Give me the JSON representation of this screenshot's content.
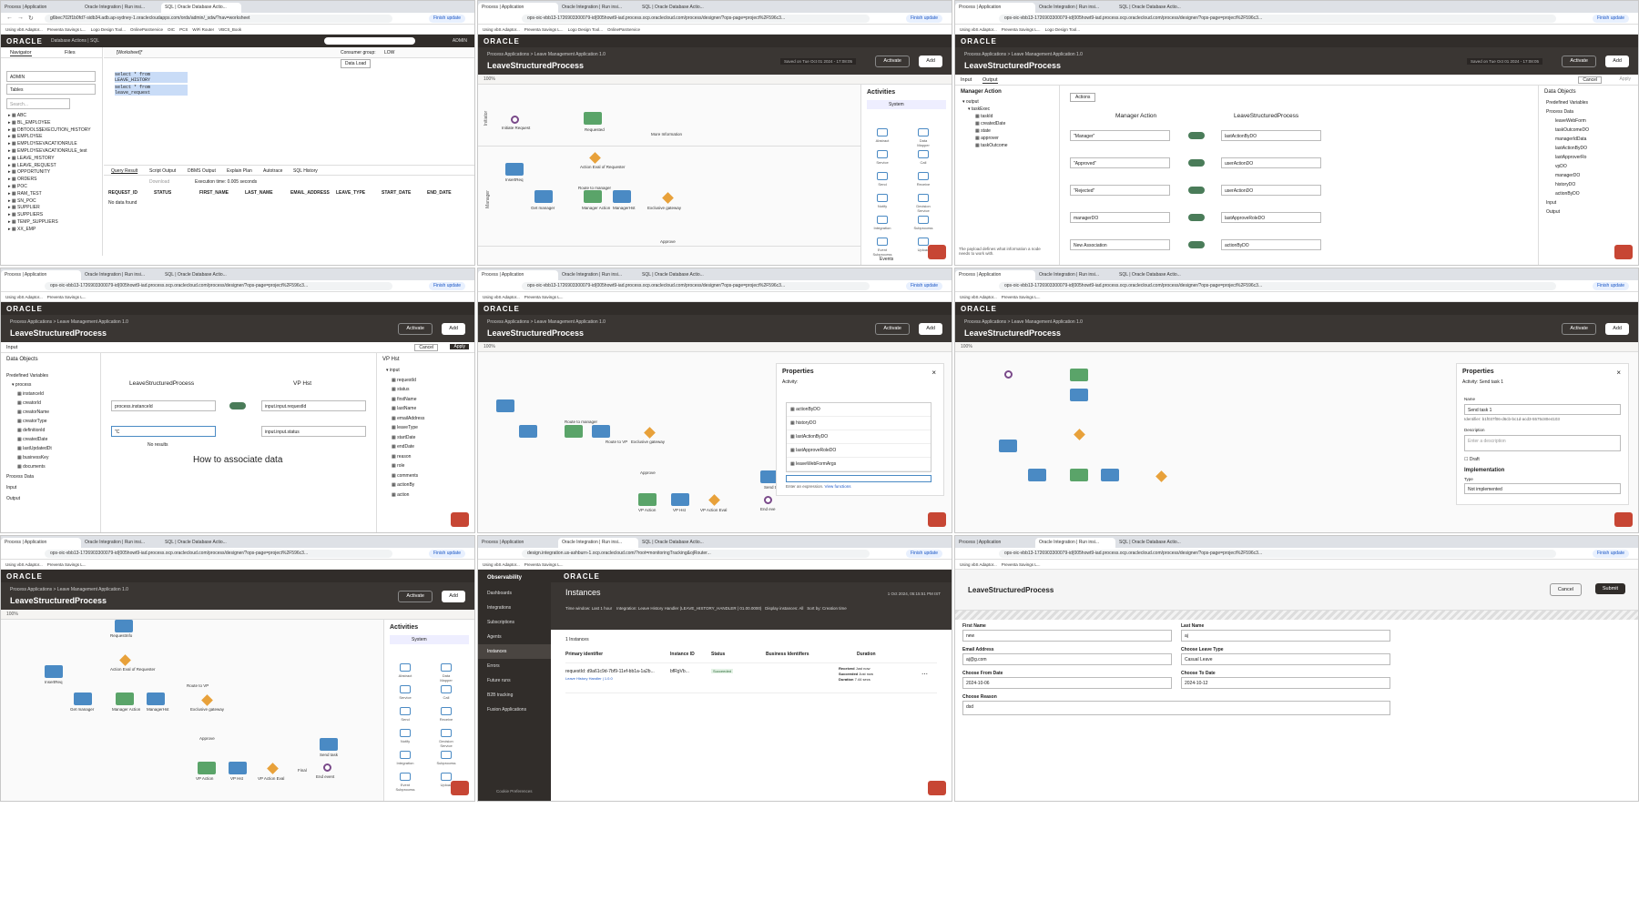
{
  "panels": [
    {
      "id": "p1",
      "tabs": [
        "Process | Application",
        "Oracle Integration | Run insi...",
        "SQL | Oracle Database Actio..."
      ],
      "url": "g6bec702f1b0fd7-sidb34.adb.ap-sydney-1.oraclecloudapps.com/ords/admin/_sdw/?nav=worksheet",
      "app_title": "Database Actions | SQL",
      "nav_tabs": [
        "Navigator",
        "Files"
      ],
      "schema": "ADMIN",
      "object_type": "Tables",
      "search_placeholder": "Search...",
      "tables": [
        "ABC",
        "BL_EMPLOYEE",
        "DBTOOLS$EXECUTION_HISTORY",
        "EMPLOYEE",
        "EMPLOYEEVACATIONRULE",
        "EMPLOYEEVACATIONRULE_test",
        "LEAVE_HISTORY",
        "LEAVE_REQUEST",
        "OPPORTUNITY",
        "ORDERS",
        "POC",
        "RAM_TEST",
        "SN_POC",
        "SUPPLIER",
        "SUPPLIERS",
        "TEMP_SUPPLIERS",
        "XX_EMP"
      ],
      "worksheet": "[Worksheet]*",
      "consumer_group_label": "Consumer group:",
      "consumer_group": "LOW",
      "data_load": "Data Load",
      "sql_lines": [
        "select * from LEAVE_HISTORY",
        "select * from leave_request"
      ],
      "result_tabs": [
        "Query Result",
        "Script Output",
        "DBMS Output",
        "Explain Plan",
        "Autotrace",
        "SQL History"
      ],
      "download": "Download",
      "exec_time": "Execution time: 0.005 seconds",
      "columns": [
        "REQUEST_ID",
        "STATUS",
        "FIRST_NAME",
        "LAST_NAME",
        "EMAIL_ADDRESS",
        "LEAVE_TYPE",
        "START_DATE",
        "END_DATE"
      ],
      "no_data": "No data found",
      "user": "ADMIN"
    },
    {
      "id": "p2",
      "crumb": "Process Applications  >  Leave Management Application 1.0",
      "title": "LeaveStructuredProcess",
      "activate": "Activate",
      "add": "Add",
      "zoom": "100%",
      "palette_title": "Activities",
      "palette_section": "System",
      "palette_items": [
        "Abstract",
        "Data Mapper",
        "Service",
        "Call",
        "Send",
        "Receive",
        "Notify",
        "Decision Service",
        "Integration",
        "Subprocess",
        "Event Subprocess",
        "Upload"
      ],
      "events": "Events",
      "nodes": [
        "Initiate Request",
        "Requested",
        "More Information",
        "Action Eval of Requester",
        "InsertReq",
        "Get manager",
        "Manager Action",
        "ManagerHst",
        "Exclusive gateway",
        "Route to manager",
        "Approve"
      ],
      "lanes": [
        "Initiator",
        "Manager",
        "VP"
      ]
    },
    {
      "id": "p3",
      "tabs_io": [
        "Input",
        "Output"
      ],
      "cancel": "Cancel",
      "apply": "Apply",
      "left_title": "Manager Action",
      "actions": "Actions",
      "center_left": "Manager Action",
      "center_right": "LeaveStructuredProcess",
      "output_tree": [
        "output",
        "taskExec",
        "taskId",
        "createdDate",
        "state",
        "approver",
        "taskOutcome"
      ],
      "mappings": [
        {
          "src": "\"Manager\"",
          "dst": "lastActionByDO"
        },
        {
          "src": "\"Approved\"",
          "dst": "userActionDO"
        },
        {
          "src": "\"Rejected\"",
          "dst": "userActionDO"
        },
        {
          "src": "managerDO",
          "dst": "lastApproveRoleDO"
        },
        {
          "src": "New Association",
          "dst": "actionByDO"
        }
      ],
      "data_objects_title": "Data Objects",
      "data_objects": [
        "Predefined Variables",
        "Process Data",
        "leaveWebForm",
        "taskOutcomeDO",
        "managerIdData",
        "lastActionByDO",
        "lastApproverRo",
        "vpDO",
        "managerDO",
        "historyDO",
        "actionByDO",
        "Input",
        "Output"
      ],
      "hint": "The payload defines what information a node needs to work with."
    },
    {
      "id": "p4",
      "input_tab": "Input",
      "cancel": "Cancel",
      "apply": "Apply",
      "data_objects_title": "Data Objects",
      "predefined": "Predefined Variables",
      "process_tree": [
        "process",
        "instanceId",
        "creatorId",
        "creatorName",
        "creatorType",
        "definitionId",
        "createdDate",
        "lastUpdatedDt",
        "businessKey",
        "documents"
      ],
      "process_data": "Process Data",
      "input": "Input",
      "output": "Output",
      "center_left": "LeaveStructuredProcess",
      "center_right": "VP Hst",
      "map_src": "process.instanceId",
      "map_dst": "input.input.requestId",
      "map_dst2": "input.input.status",
      "typing": "\"C",
      "no_results": "No results",
      "howto_title": "How to associate data",
      "right_title": "VP Hst",
      "right_tree": [
        "input",
        "requestId",
        "status",
        "firstName",
        "lastName",
        "emailAddress",
        "leaveType",
        "startDate",
        "endDate",
        "reason",
        "role",
        "comments",
        "actionBy",
        "action"
      ]
    },
    {
      "id": "p5",
      "props_title": "Properties",
      "props_sub": "Activity:",
      "list_items": [
        "actionByDO",
        "historyDO",
        "lastActionByDO",
        "lastApproveRoleDO",
        "leaveWebFormArgs"
      ],
      "expr_hint": "Enter an expression.",
      "view_functions": "View functions",
      "nodes": [
        "VP Action",
        "VP Hst",
        "VP Action Eval",
        "End eve",
        "Send ta",
        "Approve",
        "Exclusive gateway",
        "Route to VP",
        "Route to manager"
      ]
    },
    {
      "id": "p6",
      "props_title": "Properties",
      "props_sub": "Activity: Send task 1",
      "name_label": "Name",
      "name_value": "Send task 1",
      "identifier": "Identifier: b1f037f06-d6cb-bc1d-acd3-5575c80e4103",
      "desc_label": "Description",
      "desc_placeholder": "Enter a description",
      "draft": "Draft",
      "impl_title": "Implementation",
      "type_label": "Type",
      "type_value": "Not implemented"
    },
    {
      "id": "p7",
      "palette_title": "Activities",
      "palette_section": "System",
      "nodes": [
        "RequestInfo",
        "Action Eval of Requester",
        "InsertReq",
        "Get manager",
        "Manager Action",
        "ManagerHst",
        "Exclusive gateway",
        "Route to VP",
        "Approve",
        "VP Action",
        "VP Hst",
        "VP Action Eval",
        "Send task",
        "End event",
        "Final"
      ]
    },
    {
      "id": "p8",
      "url": "design.integration.us-ashburn-1.ocp.oraclecloud.com/?root=monitoringTracking&ojRouter...",
      "section": "Observability",
      "nav_items": [
        "Dashboards",
        "Integrations",
        "Subscriptions",
        "Agents",
        "Instances",
        "Errors",
        "Future runs",
        "B2B tracking",
        "Fusion Applications"
      ],
      "cookie": "Cookie Preferences",
      "page_title": "Instances",
      "time_filter": "Time window: Last 1 hour",
      "integration_filter": "Integration: Leave History Handler (LEAVE_HISTORY_HANDLER | 01.00.0000)",
      "display_filter": "Display instances: All",
      "sort": "Sort by: Creation time",
      "updated": "1 Oct 2024, 05:15:51 PM IST",
      "count": "1 Instances",
      "cols": [
        "Primary identifier",
        "Instance ID",
        "Status",
        "Business Identifiers",
        "Duration"
      ],
      "row": {
        "primary": "requestId: d9a61c9d-7bf9-11ef-bb1a-1a2b...",
        "sub": "Leave History Handler | 1.0.0",
        "instance": "bfRgVb...",
        "status": "Succeeded",
        "received": "Just now",
        "succeeded": "Just now",
        "duration": "7.44 secs"
      },
      "duration_labels": [
        "Received",
        "Succeeded",
        "Duration"
      ]
    },
    {
      "id": "p9",
      "form_title": "LeaveStructuredProcess",
      "cancel": "Cancel",
      "submit": "Submit",
      "fields": [
        {
          "label": "First Name",
          "value": "new"
        },
        {
          "label": "Last Name",
          "value": "aj"
        },
        {
          "label": "Email Address",
          "value": "aj@g.com"
        },
        {
          "label": "Choose Leave Type",
          "value": "Casual Leave"
        },
        {
          "label": "Choose From Date",
          "value": "2024-10-06"
        },
        {
          "label": "Choose To Date",
          "value": "2024-10-12"
        },
        {
          "label": "Choose Reason",
          "value": "dsd"
        }
      ]
    }
  ],
  "common": {
    "tabs": [
      "Process | Application",
      "Oracle Integration | Run insi...",
      "SQL | Oracle Database Actio..."
    ],
    "designer_url": "ops-oic-vbb13-1726903300079-id{005howt9-iad.process.ocp.oraclecloud.com/process/designer/?ops-page=project%2F596c3...",
    "finish": "Finish update",
    "bookmarks": [
      "Using vbS Adaptor...",
      "Preventa Savings L...",
      "Logo Design Tool...",
      "OnlinePanService",
      "OIC",
      "PCS",
      "OIC",
      "WiFi Router",
      "VBCS_Book",
      "All Bookmarks"
    ],
    "oracle": "ORACLE",
    "crumb": "Process Applications  >  Leave Management Application 1.0",
    "title": "LeaveStructuredProcess",
    "saved": "Saved on Tue Oct 01 2024 - 17:08:05",
    "activate": "Activate",
    "add": "Add",
    "zoom": "100%"
  }
}
